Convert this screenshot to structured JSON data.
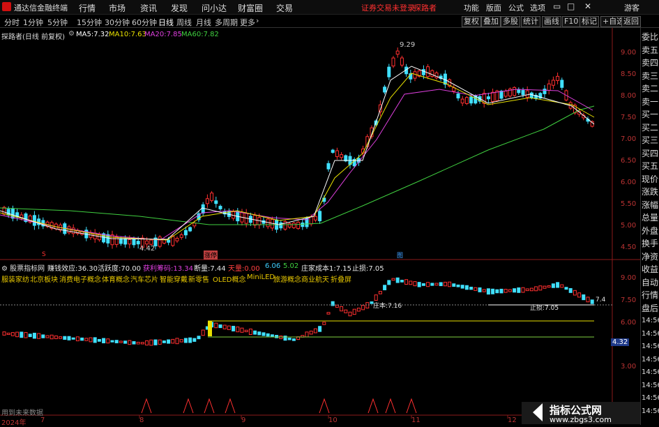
{
  "titlebar": {
    "app_title": "通达信金融终端",
    "menu": [
      "行情",
      "市场",
      "资讯",
      "发现",
      "问小达",
      "财富圈",
      "交易"
    ],
    "login_notice": "证券交易未登录",
    "username": "探路者",
    "right_menu": [
      "功能",
      "版面",
      "公式",
      "选项"
    ],
    "guest": "游客"
  },
  "periodbar": {
    "periods": [
      "分时",
      "1分钟",
      "5分钟",
      "15分钟",
      "30分钟",
      "60分钟",
      "日线",
      "周线",
      "月线",
      "多周期",
      "更多"
    ],
    "active_period": "日线",
    "tools": [
      "复权",
      "叠加",
      "多股",
      "统计",
      "画线",
      "F10",
      "标记",
      "+自选",
      "返回"
    ]
  },
  "main_chart": {
    "stock_label": "探路者(日线 前复权)",
    "ma": [
      {
        "label": "MA5:",
        "value": "7.32",
        "color": "#ffffff"
      },
      {
        "label": "MA10:",
        "value": "7.63",
        "color": "#e8e000"
      },
      {
        "label": "MA20:",
        "value": "7.85",
        "color": "#e040e0"
      },
      {
        "label": "MA60:",
        "value": "7.82",
        "color": "#40d040"
      }
    ],
    "high_label": "9.29",
    "low_label": "4.42",
    "yticks": [
      "9.00",
      "8.50",
      "8.00",
      "7.50",
      "7.00",
      "6.50",
      "6.00",
      "5.50",
      "5.00",
      "4.50"
    ],
    "markers": [
      "S",
      "涨停",
      "图"
    ]
  },
  "indicator": {
    "name": "股票指标网",
    "fields": [
      {
        "label": "赚钱效应:",
        "value": "36.30",
        "color": "#e8e8e8"
      },
      {
        "label": "活跃度:",
        "value": "70.00",
        "color": "#e8e8e8"
      },
      {
        "label": "获利筹码:",
        "value": "13.34",
        "color": "#e040e0"
      },
      {
        "label": "断量:",
        "value": "7.44",
        "color": "#e8e8e8"
      },
      {
        "label": "天量:",
        "value": "0.00",
        "color": "#ff4040"
      },
      {
        "label": "",
        "value": "6.06",
        "color": "#40d0ff"
      },
      {
        "label": "",
        "value": "5.02",
        "color": "#40d040"
      },
      {
        "label": "庄家成本1:",
        "value": "7.15",
        "color": "#e8e8e8"
      },
      {
        "label": "止损:",
        "value": "7.05",
        "color": "#e8e8e8"
      }
    ],
    "concepts": [
      "服装家纺",
      "北京板块",
      "消费电子概念",
      "体育概念",
      "汽车芯片",
      "智能穿戴",
      "新零售",
      "OLED概念",
      "MiniLED",
      "旅游概念",
      "商业航天",
      "折叠屏"
    ],
    "cost_label": "庄本:7.16",
    "stop_label": "止损:7.05",
    "last_label": "7.4",
    "yticks": [
      "9.00",
      "7.50",
      "6.00",
      "4.32",
      "3.00"
    ],
    "current_price": "4.32",
    "footer_note": "用到未来数据"
  },
  "xaxis": {
    "labels": [
      "2024年",
      "7",
      "8",
      "9",
      "10",
      "11",
      "12"
    ]
  },
  "sidepanel": {
    "items": [
      "委比",
      "卖五",
      "卖四",
      "卖三",
      "卖二",
      "卖一",
      "买一",
      "买二",
      "买三",
      "买四",
      "买五",
      "现价",
      "涨跌",
      "涨幅",
      "总量",
      "外盘",
      "换手",
      "净资",
      "收益",
      "自动",
      "行情",
      "盘后",
      "14:56",
      "14:56",
      "14:56",
      "14:56",
      "14:56",
      "14:56",
      "14:56",
      "14:56"
    ]
  },
  "watermark": {
    "title": "指标公式网",
    "url": "www.zbgs3.com"
  },
  "colors": {
    "up": "#ff3030",
    "down": "#40e0ff",
    "ma5": "#ffffff",
    "ma10": "#e8e000",
    "ma20": "#e040e0",
    "ma60": "#40d040",
    "axis": "#b33333",
    "login": "#ff3030"
  }
}
